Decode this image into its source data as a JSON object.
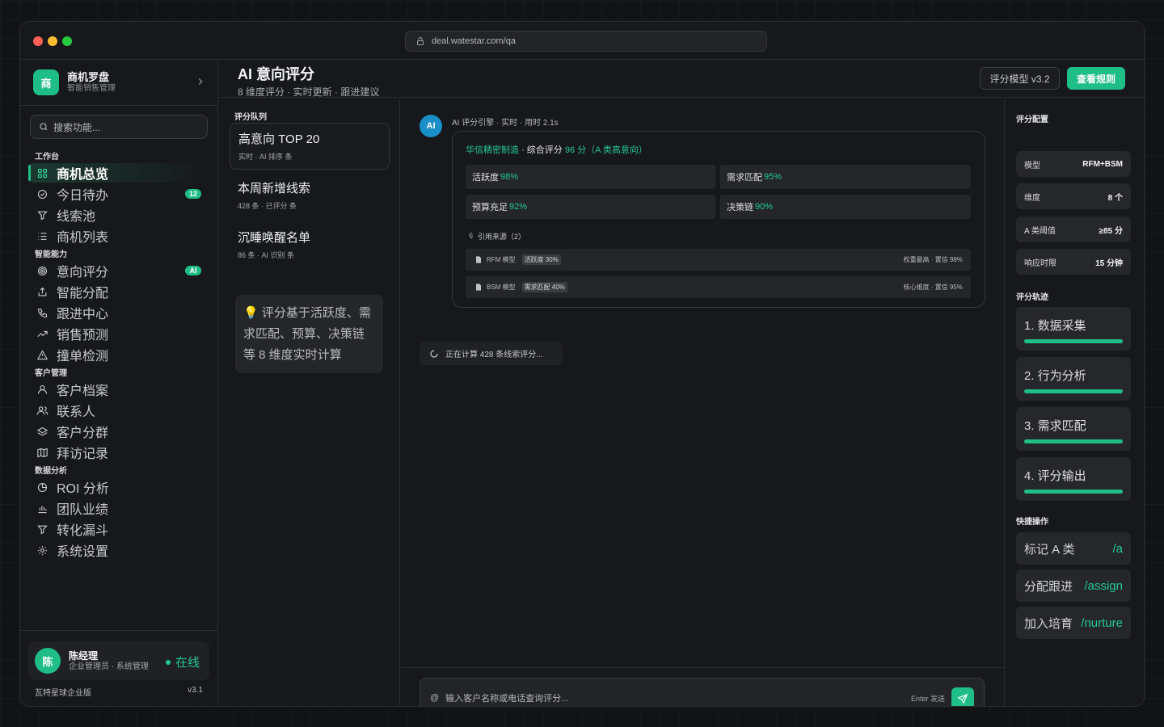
{
  "browser": {
    "url": "deal.watestar.com/qa"
  },
  "brand": {
    "logo_char": "商",
    "name": "商机罗盘",
    "subtitle": "智能销售管理"
  },
  "search": {
    "placeholder": "搜索功能..."
  },
  "sidebar": {
    "sections": [
      {
        "title": "工作台",
        "items": [
          {
            "label": "商机总览",
            "icon": "grid-icon",
            "active": true
          },
          {
            "label": "今日待办",
            "icon": "check-circle-icon",
            "badge": "12"
          },
          {
            "label": "线索池",
            "icon": "filter-icon"
          },
          {
            "label": "商机列表",
            "icon": "list-icon"
          }
        ]
      },
      {
        "title": "智能能力",
        "items": [
          {
            "label": "意向评分",
            "icon": "target-icon",
            "badge": "AI"
          },
          {
            "label": "智能分配",
            "icon": "share-icon"
          },
          {
            "label": "跟进中心",
            "icon": "phone-icon"
          },
          {
            "label": "销售预测",
            "icon": "trend-icon"
          },
          {
            "label": "撞单检测",
            "icon": "warning-icon"
          }
        ]
      },
      {
        "title": "客户管理",
        "items": [
          {
            "label": "客户档案",
            "icon": "user-icon"
          },
          {
            "label": "联系人",
            "icon": "users-icon"
          },
          {
            "label": "客户分群",
            "icon": "layers-icon"
          },
          {
            "label": "拜访记录",
            "icon": "map-icon"
          }
        ]
      },
      {
        "title": "数据分析",
        "items": [
          {
            "label": "ROI 分析",
            "icon": "pie-icon"
          },
          {
            "label": "团队业绩",
            "icon": "bar-chart-icon"
          },
          {
            "label": "转化漏斗",
            "icon": "funnel-icon"
          },
          {
            "label": "系统设置",
            "icon": "gear-icon"
          }
        ]
      }
    ]
  },
  "user": {
    "avatar_char": "陈",
    "name": "陈经理",
    "role": "企业管理员 · 系统管理",
    "status": "在线"
  },
  "footer": {
    "left": "瓦特星球企业版",
    "right": "v3.1"
  },
  "header": {
    "title": "AI 意向评分",
    "subtitle": "8 维度评分 · 实时更新 · 跟进建议",
    "model_pill": "评分模型 v3.2",
    "rules_button": "查看规则"
  },
  "queue": {
    "title": "评分队列",
    "items": [
      {
        "title": "高意向 TOP 20",
        "meta": "实时 · AI 排序 条"
      },
      {
        "title": "本周新增线索",
        "meta": "428 条 · 已评分 条"
      },
      {
        "title": "沉睡唤醒名单",
        "meta": "86 条 · AI 识别 条"
      }
    ],
    "tip": "💡 评分基于活跃度、需求匹配、预算、决策链等 8 维度实时计算"
  },
  "chat": {
    "ai_avatar": "AI",
    "ai_meta": "AI 评分引擎 · 实时 · 用时 2.1s",
    "answer": {
      "company": "华信精密制造",
      "score_label": "· 综合评分",
      "score_value": "96 分（A 类高意向）",
      "metrics": [
        {
          "label": "活跃度",
          "value": "98%"
        },
        {
          "label": "需求匹配",
          "value": "95%"
        },
        {
          "label": "预算充足",
          "value": "92%"
        },
        {
          "label": "决策链",
          "value": "90%"
        }
      ],
      "citations_title": "引用来源（2）",
      "citations": [
        {
          "name": "RFM 模型",
          "tag": "活跃度 30%",
          "right": "权重最高 · 置信 98%"
        },
        {
          "name": "BSM 模型",
          "tag": "需求匹配 40%",
          "right": "核心维度 · 置信 95%"
        }
      ]
    },
    "loading": "正在计算 428 条线索评分...",
    "input": {
      "at": "@",
      "placeholder": "输入客户名称或电话查询评分...",
      "hint": "Enter 发送"
    }
  },
  "right_panel": {
    "config_title": "评分配置",
    "config": [
      {
        "key": "模型",
        "value": "RFM+BSM"
      },
      {
        "key": "维度",
        "value": "8 个"
      },
      {
        "key": "A 类阈值",
        "value": "≥85 分"
      },
      {
        "key": "响应时限",
        "value": "15 分钟"
      }
    ],
    "track_title": "评分轨迹",
    "steps": [
      {
        "label": "1. 数据采集",
        "progress": 1.0
      },
      {
        "label": "2. 行为分析",
        "progress": 1.0
      },
      {
        "label": "3. 需求匹配",
        "progress": 1.0
      },
      {
        "label": "4. 评分输出",
        "progress": 1.0
      }
    ],
    "actions_title": "快捷操作",
    "actions": [
      {
        "label": "标记 A 类",
        "cmd": "/a"
      },
      {
        "label": "分配跟进",
        "cmd": "/assign"
      },
      {
        "label": "加入培育",
        "cmd": "/nurture"
      }
    ]
  },
  "colors": {
    "accent": "#1fbe86",
    "accent_text": "#22c990",
    "background": "#121315",
    "panel": "#17181b"
  }
}
